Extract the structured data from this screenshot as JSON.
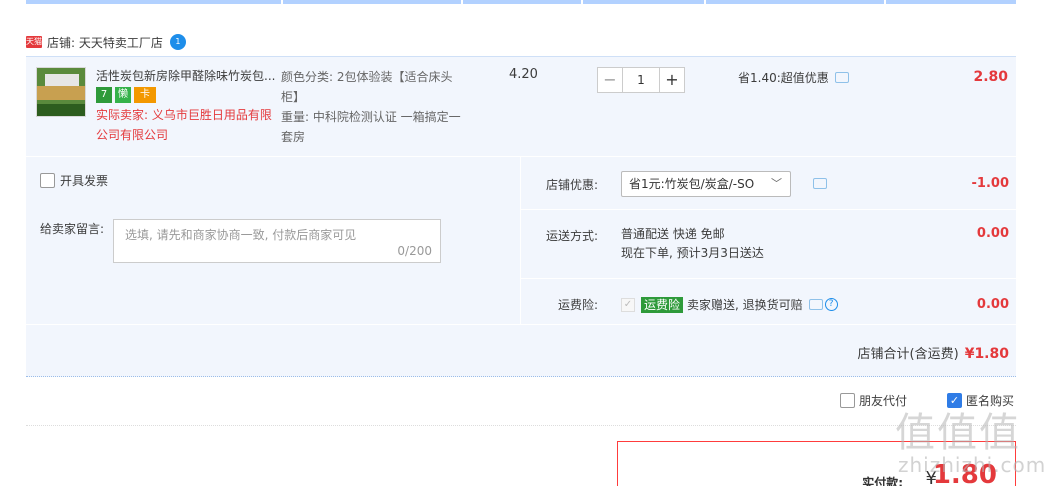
{
  "shop": {
    "badge": "天猫",
    "name": "店铺: 天天特卖工厂店",
    "ww_icon": "1"
  },
  "item": {
    "title": "活性炭包新房除甲醛除味竹炭包...",
    "badges": [
      "7",
      "懒",
      "卡"
    ],
    "seller": "实际卖家: 义乌市巨胜日用品有限公司有限公司",
    "sku_color": "颜色分类: 2包体验装【适合床头柜】",
    "sku_weight": "重量: 中科院检测认证 一箱搞定一套房",
    "unit_price": "4.20",
    "quantity": "1",
    "qty_minus": "−",
    "qty_plus": "+",
    "discount": "省1.40:超值优惠",
    "total": "2.80"
  },
  "invoice": {
    "label": "开具发票"
  },
  "message": {
    "label": "给卖家留言:",
    "placeholder": "选填, 请先和商家协商一致, 付款后商家可见",
    "count": "0/200"
  },
  "shop_discount": {
    "label": "店铺优惠:",
    "selected": "省1元:竹炭包/炭盒/-SO",
    "amount": "-1.00"
  },
  "shipping": {
    "label": "运送方式:",
    "line1": "普通配送 快递 免邮",
    "line2": "现在下单, 预计3月3日送达",
    "amount": "0.00"
  },
  "insurance": {
    "label": "运费险:",
    "tag": "运费险",
    "text": "卖家赠送, 退换货可赔",
    "amount": "0.00"
  },
  "shop_total": {
    "label": "店铺合计(含运费)",
    "amount": "¥1.80"
  },
  "options": {
    "friend_pay": "朋友代付",
    "anonymous": "匿名购买"
  },
  "payment": {
    "label": "实付款:",
    "symbol": "¥",
    "amount": "1.80"
  },
  "watermark": {
    "big": "值值值",
    "small": "zhizhizhi.com"
  },
  "colors": {
    "accent_red": "#e4393c",
    "panel_bg": "#f2f6fd",
    "link_blue": "#1e8eea"
  }
}
